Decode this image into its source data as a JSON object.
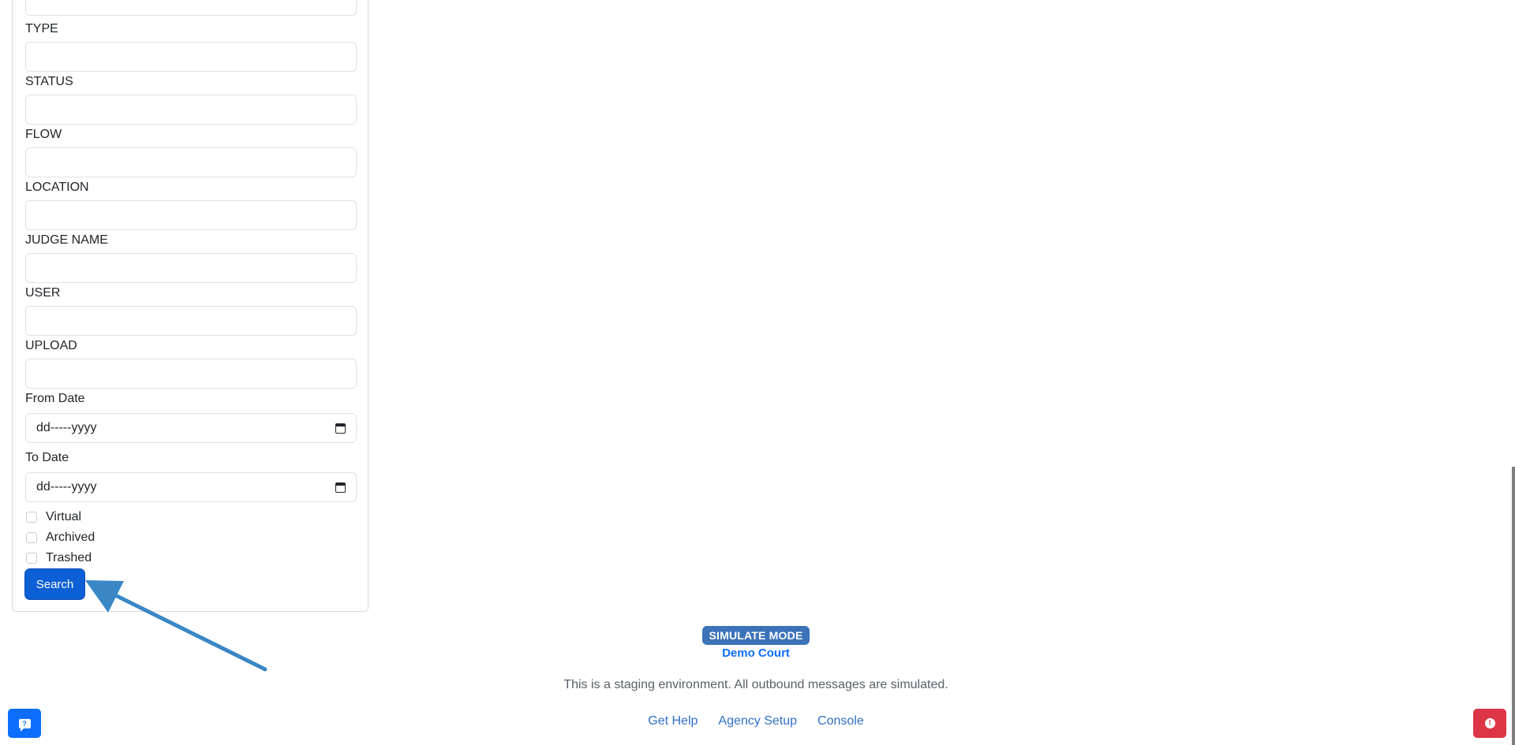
{
  "filters": {
    "fields": [
      {
        "label": "TYPE"
      },
      {
        "label": "STATUS"
      },
      {
        "label": "FLOW"
      },
      {
        "label": "LOCATION"
      },
      {
        "label": "JUDGE NAME"
      },
      {
        "label": "USER"
      },
      {
        "label": "UPLOAD"
      }
    ],
    "from_date": {
      "label": "From Date",
      "value": "dd-----yyyy"
    },
    "to_date": {
      "label": "To Date",
      "value": "dd-----yyyy"
    },
    "checkboxes": [
      {
        "label": "Virtual",
        "checked": false
      },
      {
        "label": "Archived",
        "checked": false
      },
      {
        "label": "Trashed",
        "checked": false
      }
    ],
    "search_label": "Search"
  },
  "footer": {
    "badge": "SIMULATE MODE",
    "court_name": "Demo Court",
    "note": "This is a staging environment. All outbound messages are simulated.",
    "links": [
      "Get Help",
      "Agency Setup",
      "Console"
    ]
  },
  "floating": {
    "help_icon": "help-chat-icon",
    "alert_icon": "alert-icon"
  },
  "colors": {
    "primary": "#0d6efd",
    "search_button": "#0d5fd6",
    "badge": "#3b73b9",
    "danger": "#dc3545",
    "arrow": "#3a87c6"
  }
}
